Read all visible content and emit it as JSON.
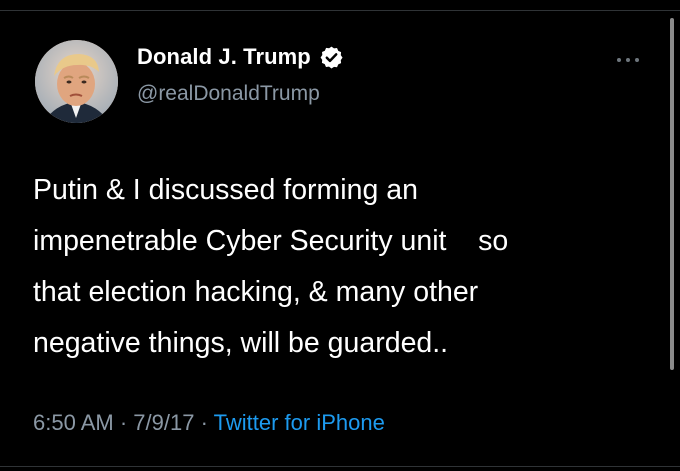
{
  "author": {
    "display_name": "Donald J. Trump",
    "handle": "@realDonaldTrump",
    "verified": true,
    "avatar_icon": "profile-photo"
  },
  "tweet": {
    "lines": [
      "Putin & I discussed forming an",
      "impenetrable Cyber Security unit    so",
      "that election hacking, & many other",
      "negative things, will be guarded.."
    ]
  },
  "meta": {
    "time": "6:50 AM",
    "date": "7/9/17",
    "separator": "·",
    "source": "Twitter for iPhone"
  },
  "icons": {
    "more": "more-horizontal-icon",
    "verified": "verified-badge-icon"
  },
  "colors": {
    "background": "#000000",
    "text": "#ffffff",
    "secondary": "#8b98a5",
    "link": "#1d9bf0"
  }
}
